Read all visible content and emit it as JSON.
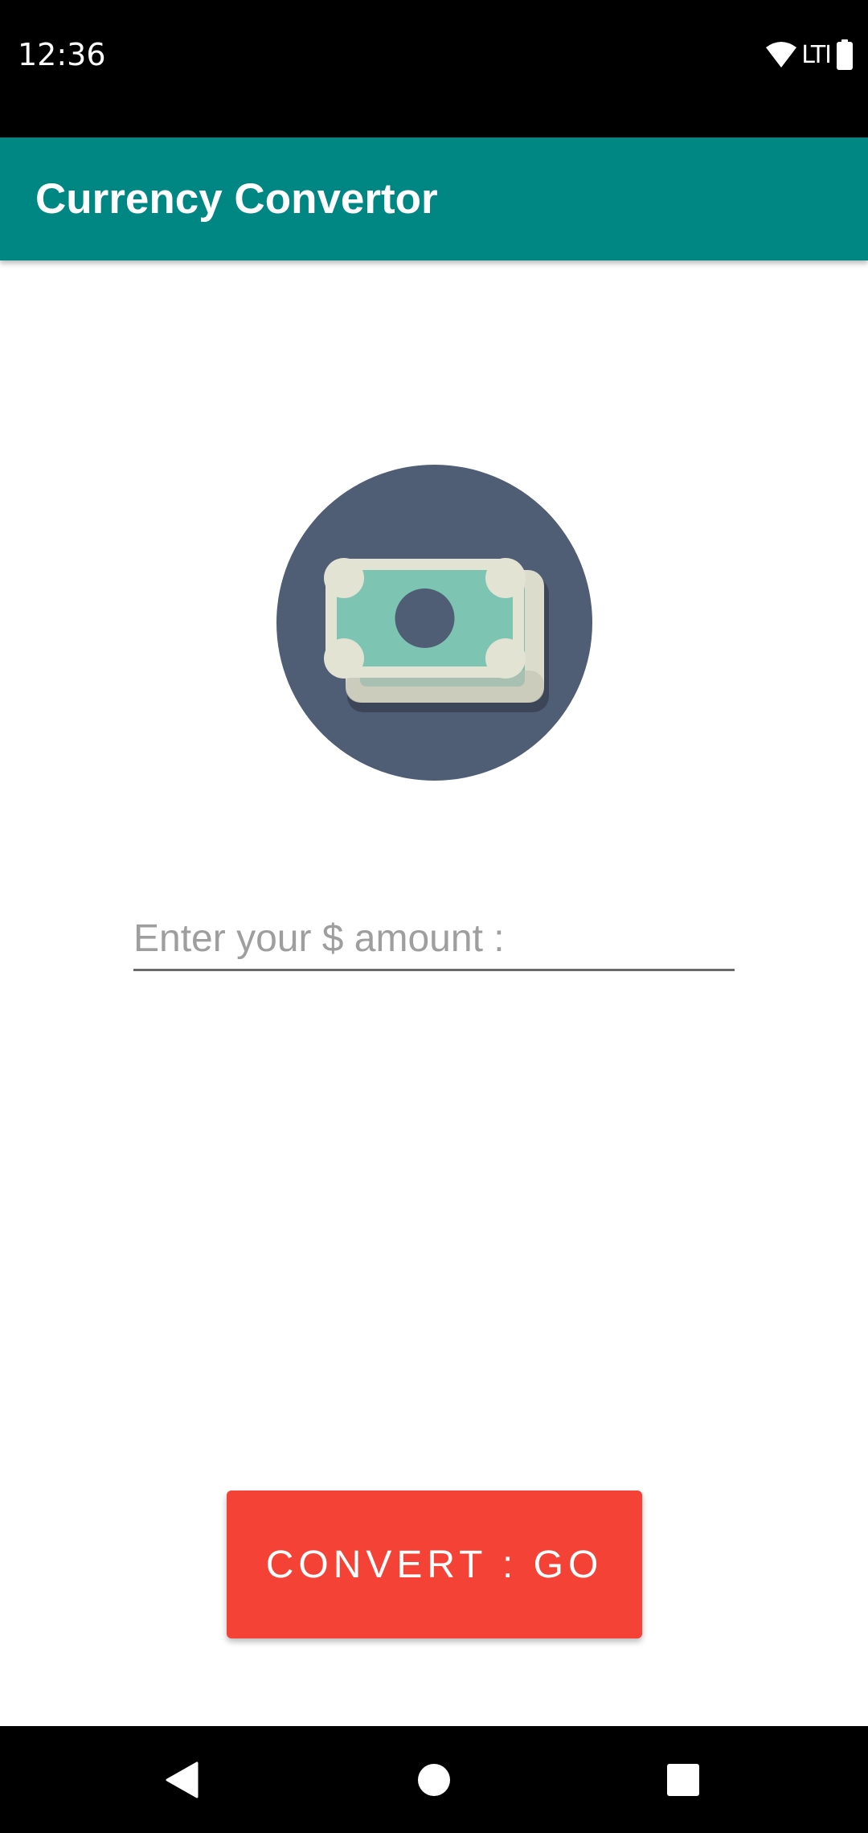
{
  "status_bar": {
    "time": "12:36",
    "network": "LTI",
    "icons": [
      "wifi-icon",
      "battery-icon"
    ]
  },
  "app_bar": {
    "title": "Currency Convertor",
    "color": "#008784"
  },
  "main": {
    "image_icon": "money-bills-icon",
    "amount_input": {
      "value": "",
      "placeholder": "Enter your $ amount :"
    },
    "convert_button": {
      "label": "CONVERT : GO",
      "color": "#f44336"
    }
  },
  "nav_bar": {
    "icons": [
      "back-icon",
      "home-icon",
      "recents-icon"
    ]
  }
}
